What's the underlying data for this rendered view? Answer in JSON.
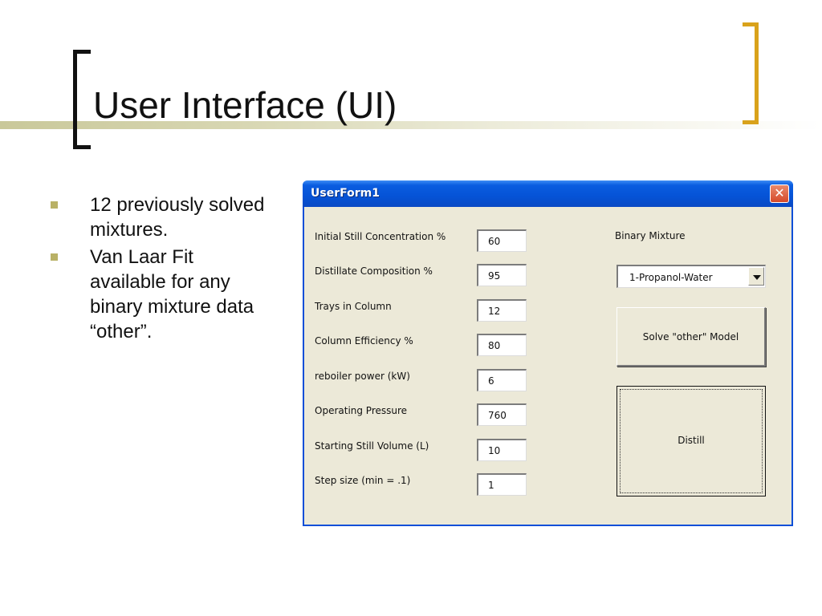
{
  "slide": {
    "title": "User Interface (UI)",
    "bullets": [
      "12 previously solved mixtures.",
      "Van Laar Fit available for any binary mixture data “other”."
    ]
  },
  "window": {
    "title": "UserForm1",
    "close_label": "✕"
  },
  "fields": [
    {
      "label": "Initial Still Concentration %",
      "value": "60"
    },
    {
      "label": "Distillate Composition %",
      "value": "95"
    },
    {
      "label": "Trays in Column",
      "value": "12"
    },
    {
      "label": "Column Efficiency %",
      "value": "80"
    },
    {
      "label": "reboiler power (kW)",
      "value": "6"
    },
    {
      "label": "Operating Pressure",
      "value": "760"
    },
    {
      "label": "Starting Still Volume (L)",
      "value": "10"
    },
    {
      "label": "Step size (min = .1)",
      "value": "1"
    }
  ],
  "mixture": {
    "label": "Binary Mixture",
    "selected": "1-Propanol-Water"
  },
  "buttons": {
    "solve_label": "Solve \"other\" Model",
    "distill_label": "Distill"
  },
  "colors": {
    "title_bar": "#0553d6",
    "window_bg": "#ece9d8",
    "bracket_left": "#111111",
    "bracket_right": "#d9a21b",
    "bullet": "#b9b166"
  }
}
